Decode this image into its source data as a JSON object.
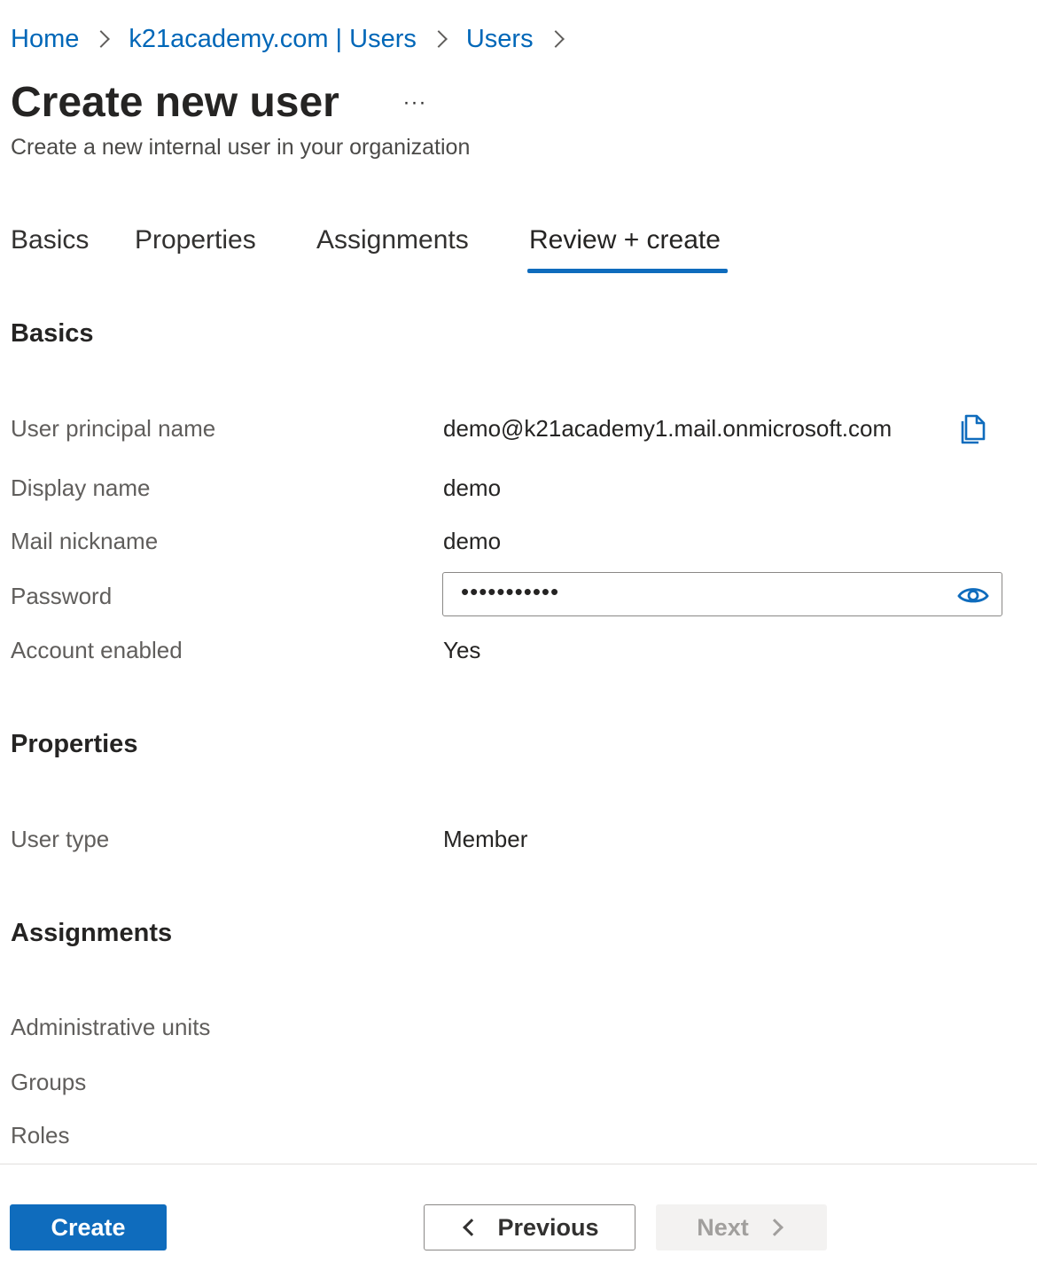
{
  "breadcrumb": {
    "items": [
      "Home",
      "k21academy.com | Users",
      "Users"
    ]
  },
  "header": {
    "title": "Create new user",
    "more_label": "···",
    "subtitle": "Create a new internal user in your organization"
  },
  "tabs": [
    "Basics",
    "Properties",
    "Assignments",
    "Review + create"
  ],
  "active_tab": "Review + create",
  "sections": {
    "basics": {
      "title": "Basics",
      "user_principal_name": {
        "label": "User principal name",
        "value": "demo@k21academy1.mail.onmicrosoft.com"
      },
      "display_name": {
        "label": "Display name",
        "value": "demo"
      },
      "mail_nickname": {
        "label": "Mail nickname",
        "value": "demo"
      },
      "password": {
        "label": "Password",
        "masked_value": "•••••••••••"
      },
      "account_enabled": {
        "label": "Account enabled",
        "value": "Yes"
      }
    },
    "properties": {
      "title": "Properties",
      "user_type": {
        "label": "User type",
        "value": "Member"
      }
    },
    "assignments": {
      "title": "Assignments",
      "administrative_units": {
        "label": "Administrative units"
      },
      "groups": {
        "label": "Groups"
      },
      "roles": {
        "label": "Roles"
      }
    }
  },
  "footer": {
    "create_label": "Create",
    "previous_label": "Previous",
    "next_label": "Next"
  },
  "icons": {
    "breadcrumb_separator": "chevron-right-icon",
    "copy": "copy-icon",
    "reveal_password": "eye-icon",
    "previous": "chevron-left-icon",
    "next": "chevron-right-icon"
  },
  "colors": {
    "accent": "#0f6cbd",
    "link": "#0067b8",
    "disabled_bg": "#f3f2f1",
    "disabled_text": "#a19f9d"
  }
}
